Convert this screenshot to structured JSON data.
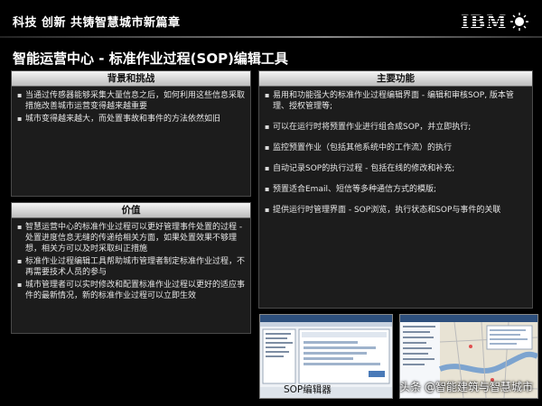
{
  "header": {
    "slogan": "科技 创新  共铸智慧城市新篇章",
    "logo_text": "IBM"
  },
  "page_title": "智能运营中心 - 标准作业过程(SOP)编辑工具",
  "background_panel": {
    "title": "背景和挑战",
    "items": [
      "当通过传感器能够采集大量信息之后，如何利用这些信息采取措施改善城市运营变得越来越重要",
      "城市变得越来越大，而处置事故和事件的方法依然如旧"
    ]
  },
  "value_panel": {
    "title": "价值",
    "items": [
      "智慧运营中心的标准作业过程可以更好管理事件处置的过程 - 处置进度信息无缝的传递给相关方面，如果处置效果不够理想，相关方可以及时采取纠正措施",
      "标准作业过程编辑工具帮助城市管理者制定标准作业过程，不再需要技术人员的参与",
      "城市管理者可以实时修改和配置标准作业过程以更好的适应事件的最新情况，新的标准作业过程可以立即生效"
    ]
  },
  "features_panel": {
    "title": "主要功能",
    "items": [
      "易用和功能强大的标准作业过程编辑界面 - 编辑和审核SOP, 版本管理、授权管理等;",
      "可以在运行时将预置作业进行组合成SOP，并立即执行;",
      "监控预置作业（包括其他系统中的工作流）的执行",
      "自动记录SOP的执行过程 - 包括在线的修改和补充;",
      "预置适合Email、短信等多种通信方式的模版;",
      "提供运行时管理界面 - SOP浏览，执行状态和SOP与事件的关联"
    ]
  },
  "screenshots": {
    "caption": "SOP编辑器"
  },
  "watermark": "头条 @智能建筑与智慧城市",
  "colors": {
    "background": "#000000",
    "panel": "#1c1c1c",
    "panel_header": "#d8d8d8"
  }
}
